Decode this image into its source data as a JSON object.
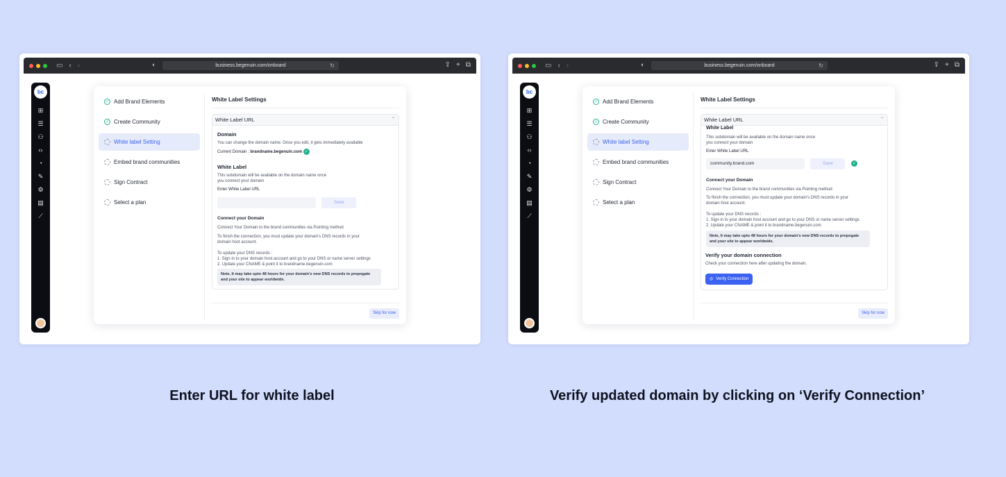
{
  "browser": {
    "url": "business.begenuin.com/onboard"
  },
  "rail": {
    "logo": "bc",
    "icons": [
      "grid-icon",
      "list-icon",
      "users-icon",
      "code-icon",
      "chart-icon",
      "wand-icon",
      "settings-icon",
      "store-icon",
      "analytics-icon"
    ]
  },
  "steps": [
    {
      "label": "Add Brand Elements",
      "state": "done"
    },
    {
      "label": "Create Community",
      "state": "done"
    },
    {
      "label": "White label Setting",
      "state": "active"
    },
    {
      "label": "Embed brand communities",
      "state": "todo"
    },
    {
      "label": "Sign Contract",
      "state": "todo"
    },
    {
      "label": "Select a plan",
      "state": "todo"
    }
  ],
  "settings_title": "White Label Settings",
  "accordion_title": "White Label URL",
  "left": {
    "domain_heading": "Domain",
    "domain_desc": "You can change the domain name. Once you edit, it gets immediately available",
    "current_domain_label": "Current Domain :",
    "current_domain_value": "brandname.begenuin.com",
    "white_label_heading": "White Label",
    "white_label_desc_1": "This subdomain will be available on the domain name once",
    "white_label_desc_2": "you connect your domain",
    "url_label": "Enter White Label URL",
    "url_value": "",
    "save_label": "Save",
    "connect_heading": "Connect your Domain",
    "connect_desc": "Connect Your Domain to the brand communities via Pointing method",
    "finish_1": "To finish the connection, you must update your domain's DNS records in your",
    "finish_2": "domain host account.",
    "dns_title": "To update your DNS records :",
    "dns_1": "1. Sign in to your domain host account and go to your DNS or name server settings",
    "dns_2": "2. Update your CNAME & point it to brandname.begenuin.com",
    "note_1": "Note, It may take upto 48 hours for your domain's new DNS records to propogate",
    "note_2": "and your site to appear worldwide.",
    "skip_label": "Skip for now"
  },
  "right": {
    "white_label_heading": "White Label",
    "white_label_desc_1": "This subdomain will be available on the domain name once",
    "white_label_desc_2": "you connect your domain",
    "url_label": "Enter White Label URL",
    "url_value": "community.brand.com",
    "save_label": "Save",
    "connect_heading": "Connect your Domain",
    "connect_desc": "Connect Your Domain to the brand communities via Pointing method",
    "finish_1": "To finish the connection, you must update your domain's DNS records in your",
    "finish_2": "domain host account.",
    "dns_title": "To update your DNS records :",
    "dns_1": "1. Sign in to your domain host account and go to your DNS or name server settings",
    "dns_2": "2. Update your CNAME & point it to brandname.begenuin.com",
    "note_1": "Note, It may take upto 48 hours for your domain's new DNS records to propogate",
    "note_2": "and your site to appear worldwide.",
    "verify_heading": "Verify your domain connection",
    "verify_desc": "Check your connection here after updating the domain.",
    "verify_button": "Verify Connection",
    "skip_label": "Skip for now"
  },
  "captions": {
    "left": "Enter URL for white label",
    "right": "Verify updated domain by clicking on ‘Verify Connection’"
  },
  "colors": {
    "background": "#d2dcfc",
    "accent": "#3b62f0",
    "success": "#21b08e"
  }
}
